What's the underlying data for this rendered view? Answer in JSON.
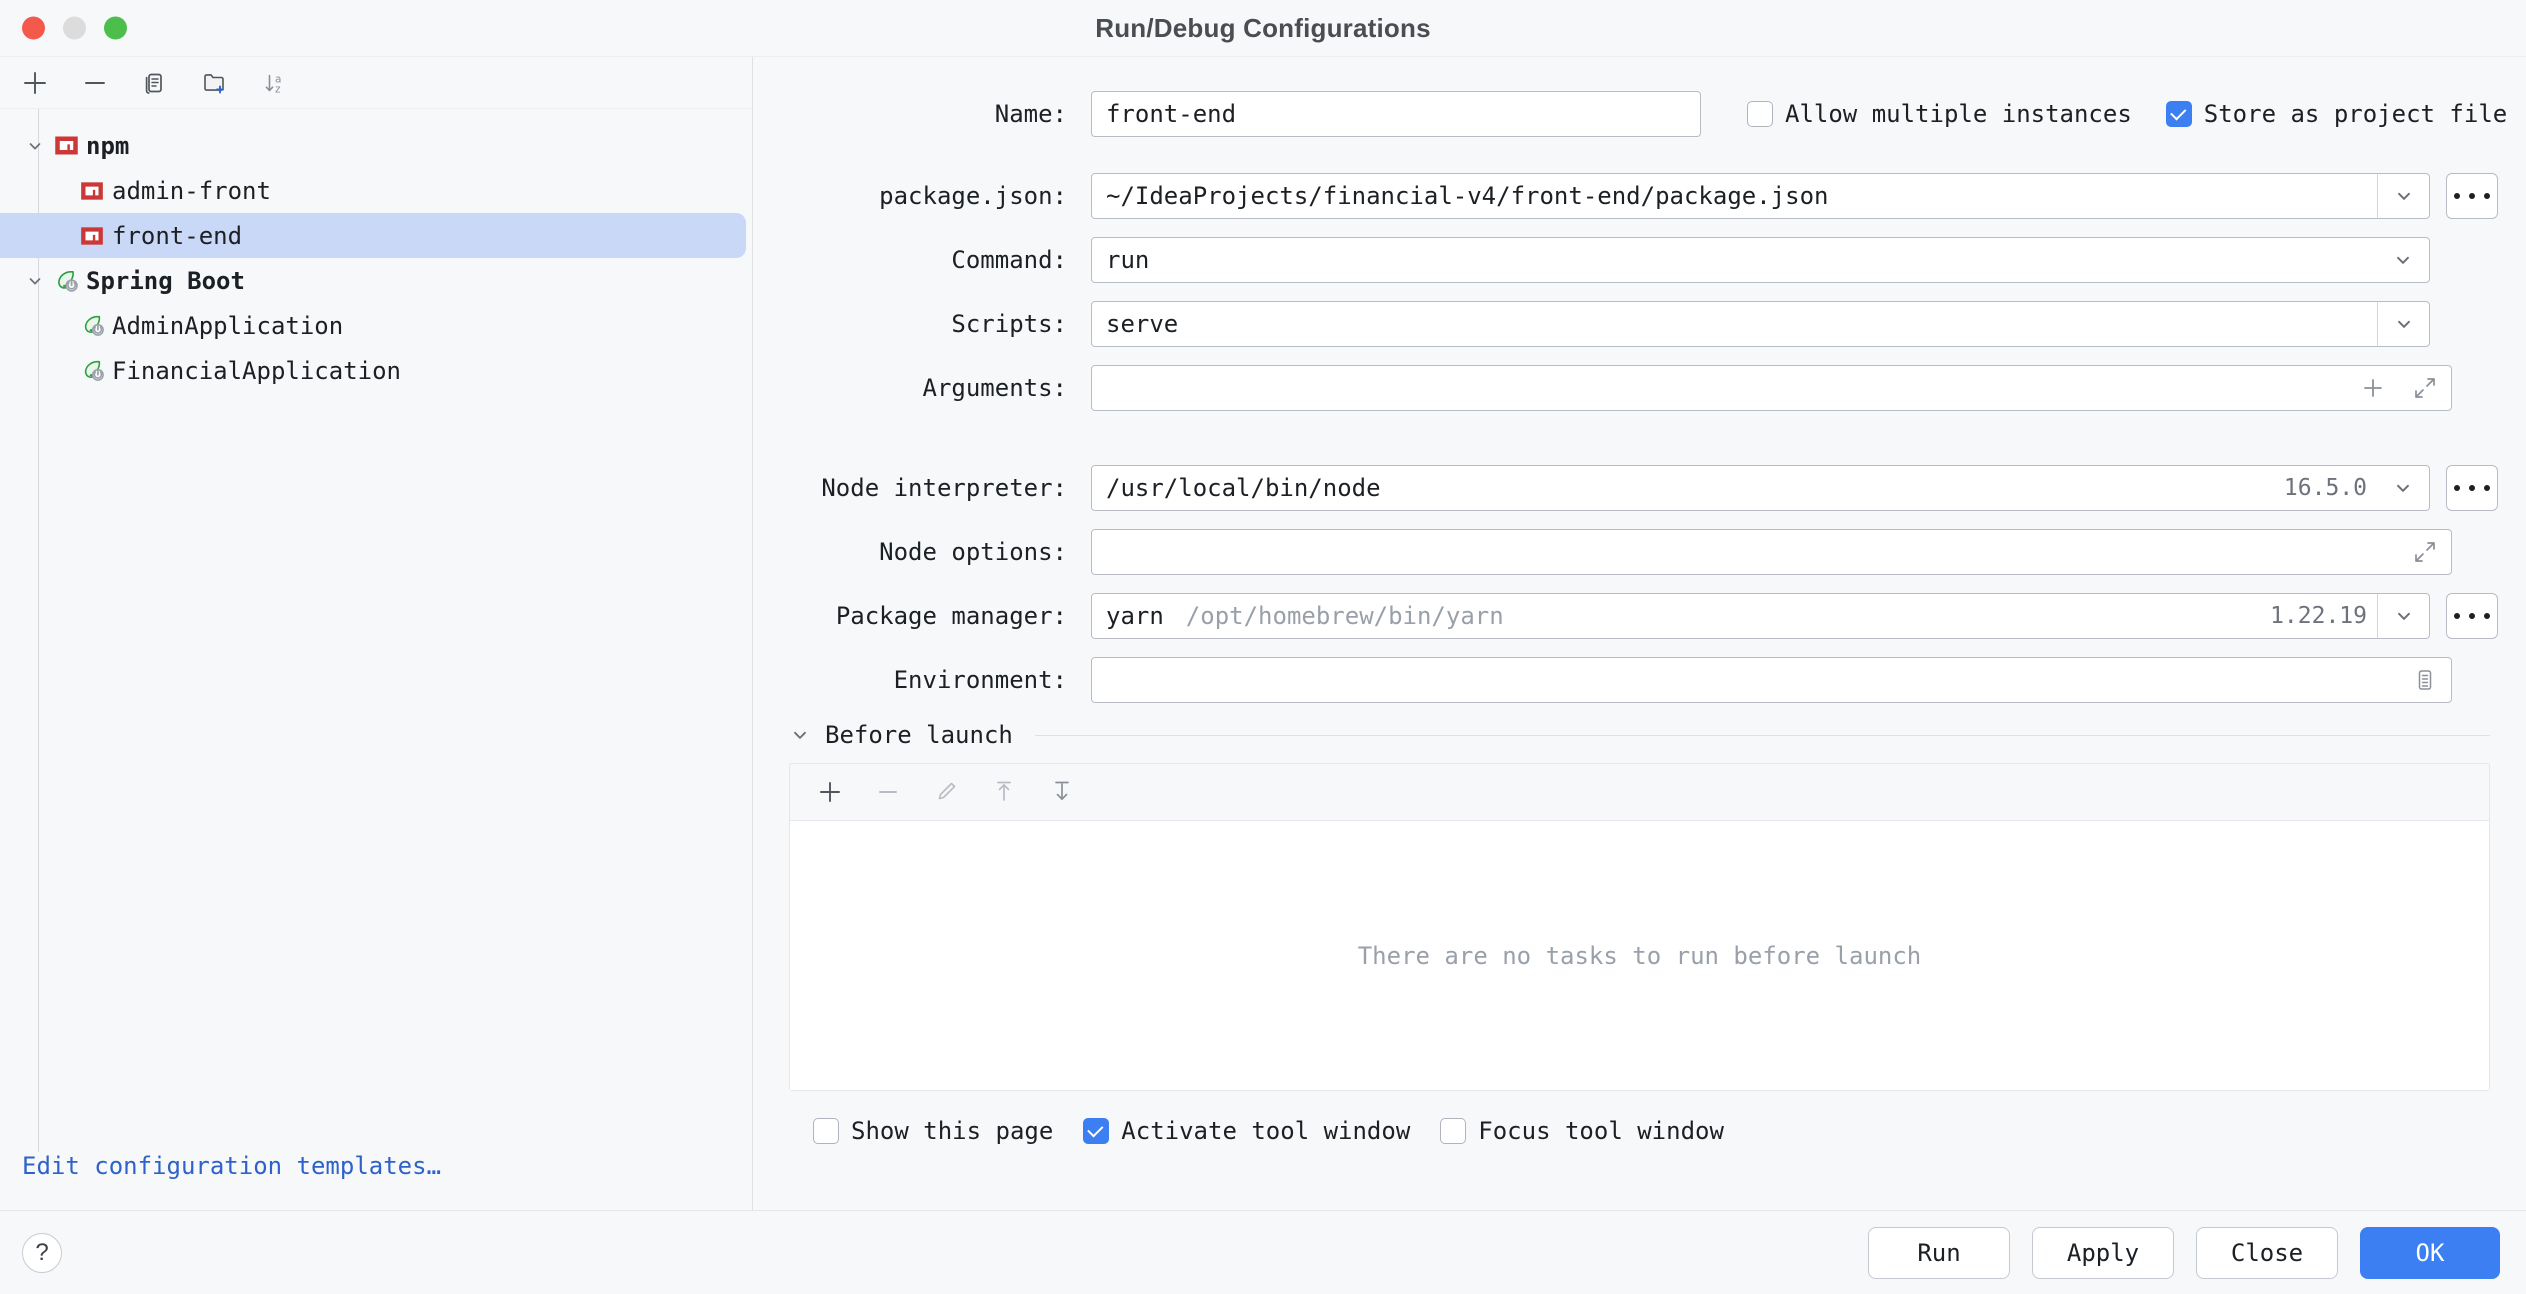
{
  "window": {
    "title": "Run/Debug Configurations",
    "controls": [
      "close-button",
      "minimize-button",
      "zoom-button"
    ]
  },
  "sidebar": {
    "toolbar": [
      {
        "name": "add-configuration-button",
        "icon": "plus-icon"
      },
      {
        "name": "remove-configuration-button",
        "icon": "minus-icon"
      },
      {
        "name": "copy-configuration-button",
        "icon": "copy-icon"
      },
      {
        "name": "new-folder-button",
        "icon": "folder-add-icon"
      },
      {
        "name": "sort-alphabetically-button",
        "icon": "sort-az-icon"
      }
    ],
    "tree": [
      {
        "label": "npm",
        "icon": "npm-icon",
        "level": 0,
        "bold": true,
        "expanded": true,
        "selected": false
      },
      {
        "label": "admin-front",
        "icon": "npm-icon",
        "level": 1,
        "bold": false,
        "expanded": null,
        "selected": false
      },
      {
        "label": "front-end",
        "icon": "npm-icon",
        "level": 1,
        "bold": false,
        "expanded": null,
        "selected": true
      },
      {
        "label": "Spring Boot",
        "icon": "spring-boot-icon",
        "level": 0,
        "bold": true,
        "expanded": true,
        "selected": false
      },
      {
        "label": "AdminApplication",
        "icon": "spring-boot-icon",
        "level": 1,
        "bold": false,
        "expanded": null,
        "selected": false
      },
      {
        "label": "FinancialApplication",
        "icon": "spring-boot-icon",
        "level": 1,
        "bold": false,
        "expanded": null,
        "selected": false
      }
    ],
    "edit_templates_link": "Edit configuration templates…"
  },
  "form": {
    "name_label": "Name:",
    "name_value": "front-end",
    "allow_multiple_instances": {
      "label": "Allow multiple instances",
      "checked": false
    },
    "store_as_project_file": {
      "label": "Store as project file",
      "checked": true,
      "icon": "gear-icon"
    },
    "package_json": {
      "label": "package.json:",
      "value": "~/IdeaProjects/financial-v4/front-end/package.json"
    },
    "command": {
      "label": "Command:",
      "value": "run"
    },
    "scripts": {
      "label": "Scripts:",
      "value": "serve"
    },
    "arguments": {
      "label": "Arguments:",
      "value": ""
    },
    "node_interpreter": {
      "label": "Node interpreter:",
      "value": "/usr/local/bin/node",
      "version": "16.5.0"
    },
    "node_options": {
      "label": "Node options:",
      "value": ""
    },
    "package_manager": {
      "label": "Package manager:",
      "value": "yarn",
      "path": "/opt/homebrew/bin/yarn",
      "version": "1.22.19"
    },
    "environment": {
      "label": "Environment:",
      "value": ""
    }
  },
  "before_launch": {
    "title": "Before launch",
    "toolbar": [
      {
        "name": "add-task-button",
        "icon": "plus-icon",
        "enabled": true
      },
      {
        "name": "remove-task-button",
        "icon": "minus-icon",
        "enabled": false
      },
      {
        "name": "edit-task-button",
        "icon": "pencil-icon",
        "enabled": false
      },
      {
        "name": "move-task-up-button",
        "icon": "arrow-up-icon",
        "enabled": false
      },
      {
        "name": "move-task-down-button",
        "icon": "arrow-down-icon",
        "enabled": false
      }
    ],
    "empty_message": "There are no tasks to run before launch",
    "checkboxes": [
      {
        "label": "Show this page",
        "checked": false
      },
      {
        "label": "Activate tool window",
        "checked": true
      },
      {
        "label": "Focus tool window",
        "checked": false
      }
    ]
  },
  "footer": {
    "help_label": "?",
    "buttons": [
      {
        "label": "Run",
        "primary": false
      },
      {
        "label": "Apply",
        "primary": false
      },
      {
        "label": "Close",
        "primary": false
      },
      {
        "label": "OK",
        "primary": true
      }
    ]
  },
  "colors": {
    "accent": "#3b7ff2",
    "selection": "#c9d8f7",
    "link": "#2f62c9",
    "npm_red": "#cb3837",
    "spring_green": "#2f9e41",
    "background": "#f7f8fa"
  }
}
